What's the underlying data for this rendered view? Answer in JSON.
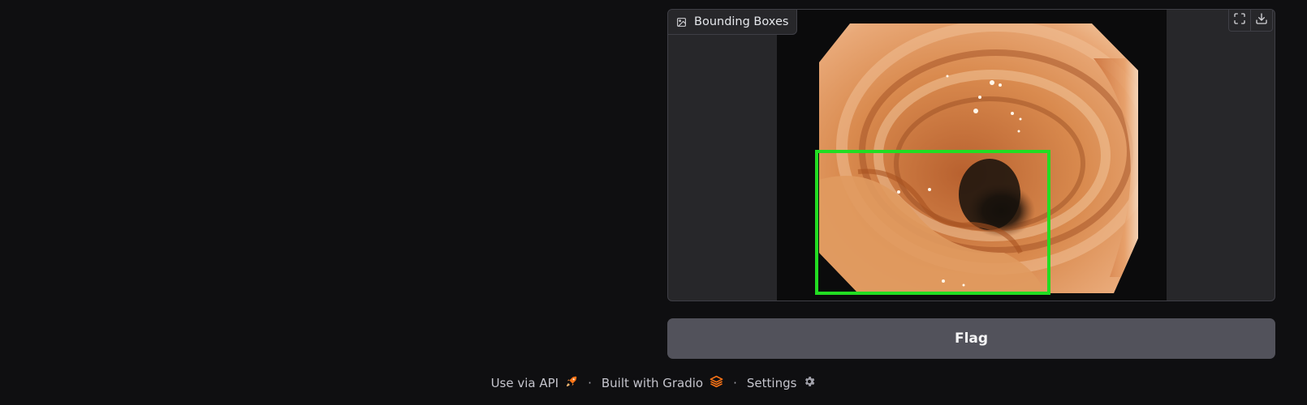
{
  "image_output": {
    "label": "Bounding Boxes",
    "label_icon": "image-icon",
    "tools": [
      "fullscreen-icon",
      "download-icon"
    ],
    "detection_box_color": "#22dd22"
  },
  "flag_button": {
    "label": "Flag"
  },
  "footer": {
    "api_link": "Use via API",
    "api_icon": "rocket-icon",
    "separator": "·",
    "built_with": "Built with Gradio",
    "gradio_icon": "gradio-logo-icon",
    "settings": "Settings",
    "settings_icon": "gear-icon",
    "accent_color": "#f97316"
  }
}
